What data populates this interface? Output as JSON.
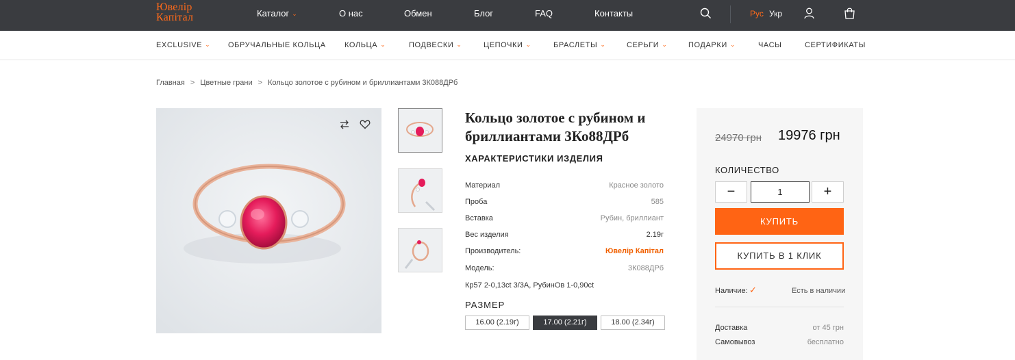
{
  "header": {
    "logo_line1": "Ювелір",
    "logo_line2": "Капітал",
    "nav": [
      {
        "label": "Каталог"
      },
      {
        "label": "О нас"
      },
      {
        "label": "Обмен"
      },
      {
        "label": "Блог"
      },
      {
        "label": "FAQ"
      },
      {
        "label": "Контакты"
      }
    ],
    "lang_ru": "Рус",
    "lang_ua": "Укр",
    "icons": [
      "search-icon",
      "user-icon",
      "cart-icon"
    ],
    "accent_color": "#ff6a1a",
    "bar_color": "#3a3c40"
  },
  "categories": [
    {
      "label": "EXCLUSIVE"
    },
    {
      "label": "ОБРУЧАЛЬНЫЕ КОЛЬЦА"
    },
    {
      "label": "КОЛЬЦА"
    },
    {
      "label": "ПОДВЕСКИ"
    },
    {
      "label": "ЦЕПОЧКИ"
    },
    {
      "label": "БРАСЛЕТЫ"
    },
    {
      "label": "СЕРЬГИ"
    },
    {
      "label": "ПОДАРКИ"
    },
    {
      "label": "ЧАСЫ"
    },
    {
      "label": "СЕРТИФИКАТЫ"
    }
  ],
  "breadcrumb": {
    "items": [
      "Главная",
      "Цветные грани",
      "Кольцо золотое с рубином и бриллиантами 3К088ДРб"
    ],
    "separator": ">"
  },
  "gallery": {
    "icons": [
      "compare-icon",
      "heart-icon"
    ]
  },
  "product": {
    "title": "Кольцо золотое с рубином и бриллиантами 3Ко88ДРб",
    "specs_heading": "ХАРАКТЕРИСТИКИ ИЗДЕЛИЯ",
    "specs": [
      {
        "label": "Материал",
        "value": "Красное золото"
      },
      {
        "label": "Проба",
        "value": "585"
      },
      {
        "label": "Вставка",
        "value": "Рубин, бриллиант"
      },
      {
        "label": "Вес изделия",
        "value": "2.19г"
      },
      {
        "label": "Производитель:",
        "value": "Ювелір Капітал"
      },
      {
        "label": "Модель:",
        "value": "3К088ДРб"
      }
    ],
    "note": "Кр57 2-0,13ct 3/3А, РубинОв 1-0,90ct",
    "size_heading": "РАЗМЕР",
    "sizes": [
      "16.00 (2.19г)",
      "17.00 (2.21г)",
      "18.00 (2.34г)"
    ],
    "selected_size": "17.00 (2.21г)"
  },
  "purchase": {
    "old_price": "24970 грн",
    "new_price": "19976 грн",
    "qty_heading": "КОЛИЧЕСТВО",
    "minus": "−",
    "qty": "1",
    "plus": "+",
    "buy_label": "КУПИТЬ",
    "oneclick_label": "КУПИТЬ В 1 КЛИК",
    "availability_label": "Наличие:",
    "availability_check": "✓",
    "availability_value": "Есть в наличии",
    "delivery": [
      {
        "label": "Доставка",
        "value": "от 45 грн"
      },
      {
        "label": "Самовывоз",
        "value": "бесплатно"
      }
    ],
    "button_color": "#ff6414"
  }
}
